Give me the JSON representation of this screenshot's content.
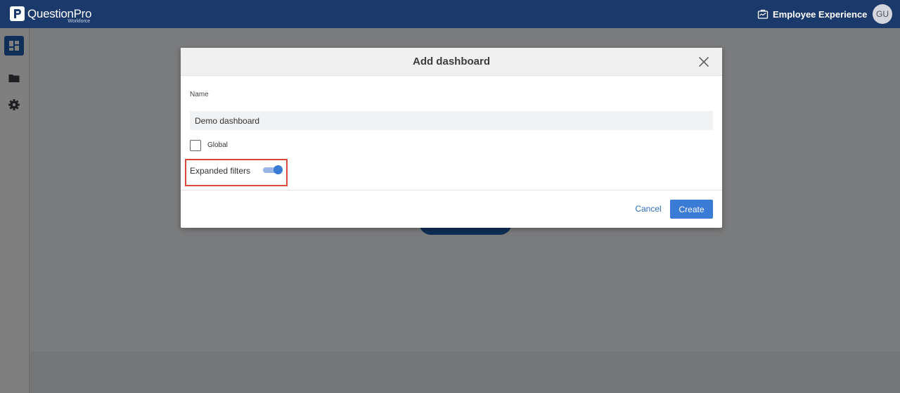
{
  "header": {
    "logo_name": "QuestionPro",
    "logo_sub": "Workforce",
    "workspace_label": "Employee Experience",
    "avatar_initials": "GU"
  },
  "sidebar": {
    "items": [
      {
        "icon": "dashboard-icon",
        "active": true
      },
      {
        "icon": "folder-icon",
        "active": false
      },
      {
        "icon": "gear-icon",
        "active": false
      }
    ]
  },
  "modal": {
    "title": "Add dashboard",
    "name_label": "Name",
    "name_value": "Demo dashboard",
    "global_label": "Global",
    "global_checked": false,
    "expanded_filters_label": "Expanded filters",
    "expanded_filters_on": true,
    "cancel_label": "Cancel",
    "create_label": "Create"
  },
  "colors": {
    "topbar": "#1b3a6b",
    "accent": "#3a7bd5",
    "highlight": "#d9483b"
  }
}
